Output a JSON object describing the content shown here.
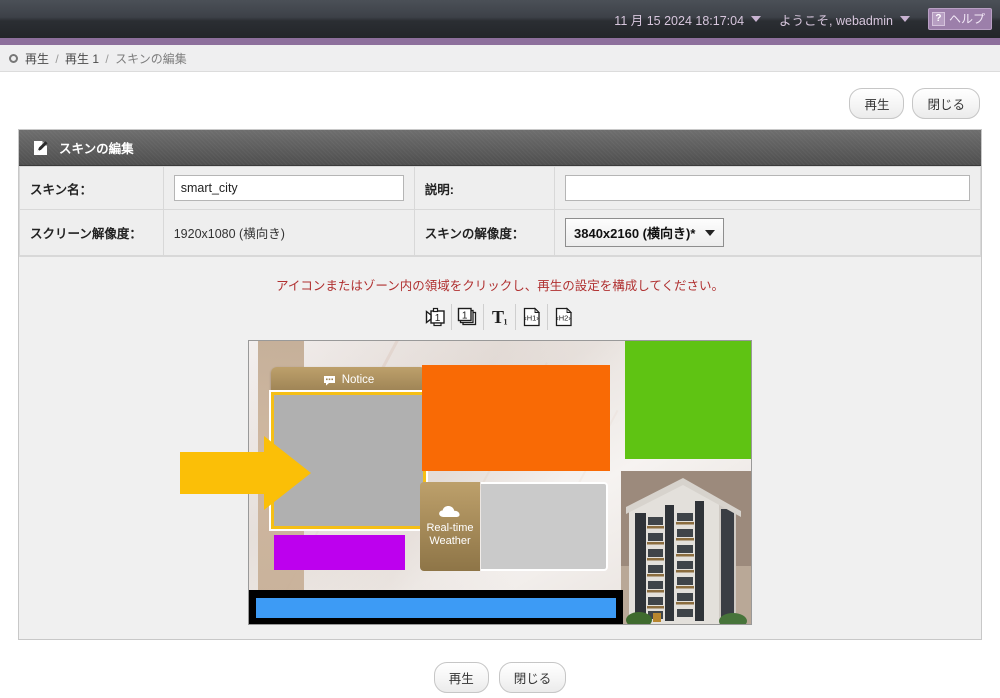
{
  "topbar": {
    "datetime": "11 月 15 2024 18:17:04",
    "user_greeting": "ようこそ, webadmin",
    "help_label": "ヘルプ",
    "help_icon": "question-mark-icon",
    "accent_color": "#8d6f9c"
  },
  "breadcrumb": {
    "items": [
      "再生",
      "再生 1",
      "スキンの編集"
    ],
    "separator": "/"
  },
  "top_actions": {
    "play_label": "再生",
    "close_label": "閉じる"
  },
  "panel": {
    "title": "スキンの編集",
    "icon": "pencil-edit-icon",
    "fields": {
      "skin_name_label": "スキン名：",
      "skin_name_value": "smart_city",
      "description_label": "説明:",
      "description_value": "",
      "screen_resolution_label": "スクリーン解像度：",
      "screen_resolution_value": "1920x1080 (横向き)",
      "skin_resolution_label": "スキンの解像度：",
      "skin_resolution_value": "3840x2160 (横向き)*"
    }
  },
  "canvas": {
    "hint": "アイコンまたはゾーン内の領域をクリックし、再生の設定を構成してください。",
    "hint_color": "#b03030",
    "toolbar_icons": [
      {
        "name": "video-zone-1-icon",
        "label": "1"
      },
      {
        "name": "image-zone-1-icon",
        "label": "1"
      },
      {
        "name": "text-zone-1-icon",
        "label": "T1"
      },
      {
        "name": "html-zone-h1-icon",
        "label": "H1"
      },
      {
        "name": "html-zone-h2-icon",
        "label": "H2"
      }
    ],
    "zones": [
      {
        "name": "notice-zone",
        "title": "Notice",
        "title_icon": "speech-bubble-icon",
        "color": "#b0b0b0",
        "selected": true,
        "selection_color": "#f5bf16"
      },
      {
        "name": "orange-zone",
        "title": "",
        "color": "#f96a05"
      },
      {
        "name": "green-zone",
        "title": "",
        "color": "#5fc313"
      },
      {
        "name": "magenta-zone",
        "title": "",
        "color": "#bd00ee"
      },
      {
        "name": "weather-zone",
        "title": "Real-time Weather",
        "title_icon": "cloud-icon",
        "color": "#cacaca"
      },
      {
        "name": "blue-ticker-zone",
        "title": "",
        "color": "#3d9bf5"
      }
    ],
    "annotation": {
      "type": "arrow",
      "direction": "right",
      "color": "#fbbf07"
    }
  },
  "bottom_actions": {
    "play_label": "再生",
    "close_label": "閉じる"
  }
}
